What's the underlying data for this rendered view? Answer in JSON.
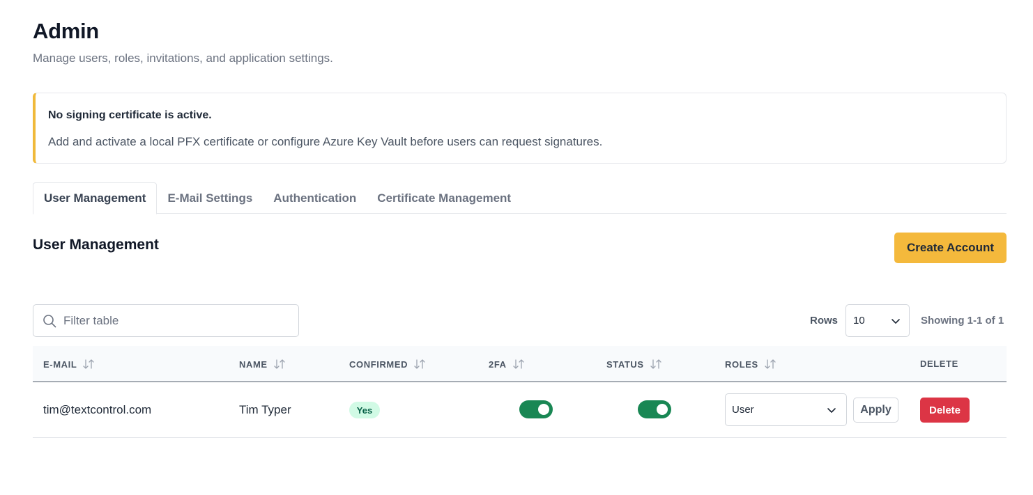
{
  "header": {
    "title": "Admin",
    "subtitle": "Manage users, roles, invitations, and application settings."
  },
  "alert": {
    "title": "No signing certificate is active.",
    "body": "Add and activate a local PFX certificate or configure Azure Key Vault before users can request signatures.",
    "accent_color": "#f0b93a"
  },
  "tabs": [
    {
      "label": "User Management",
      "active": true
    },
    {
      "label": "E-Mail Settings",
      "active": false
    },
    {
      "label": "Authentication",
      "active": false
    },
    {
      "label": "Certificate Management",
      "active": false
    }
  ],
  "section": {
    "title": "User Management",
    "create_label": "Create Account"
  },
  "toolbar": {
    "filter_placeholder": "Filter table",
    "rows_label": "Rows",
    "rows_value": "10",
    "showing_text": "Showing 1-1 of 1"
  },
  "table": {
    "columns": [
      "E-MAIL",
      "NAME",
      "CONFIRMED",
      "2FA",
      "STATUS",
      "ROLES",
      "DELETE"
    ],
    "rows": [
      {
        "email": "tim@textcontrol.com",
        "name": "Tim Typer",
        "confirmed": "Yes",
        "twofa_on": true,
        "status_on": true,
        "role": "User",
        "apply_label": "Apply",
        "delete_label": "Delete"
      }
    ]
  },
  "colors": {
    "primary_button": "#f4b93c",
    "toggle_on": "#198754",
    "danger": "#dc3545",
    "badge_bg": "#d1fae5"
  }
}
